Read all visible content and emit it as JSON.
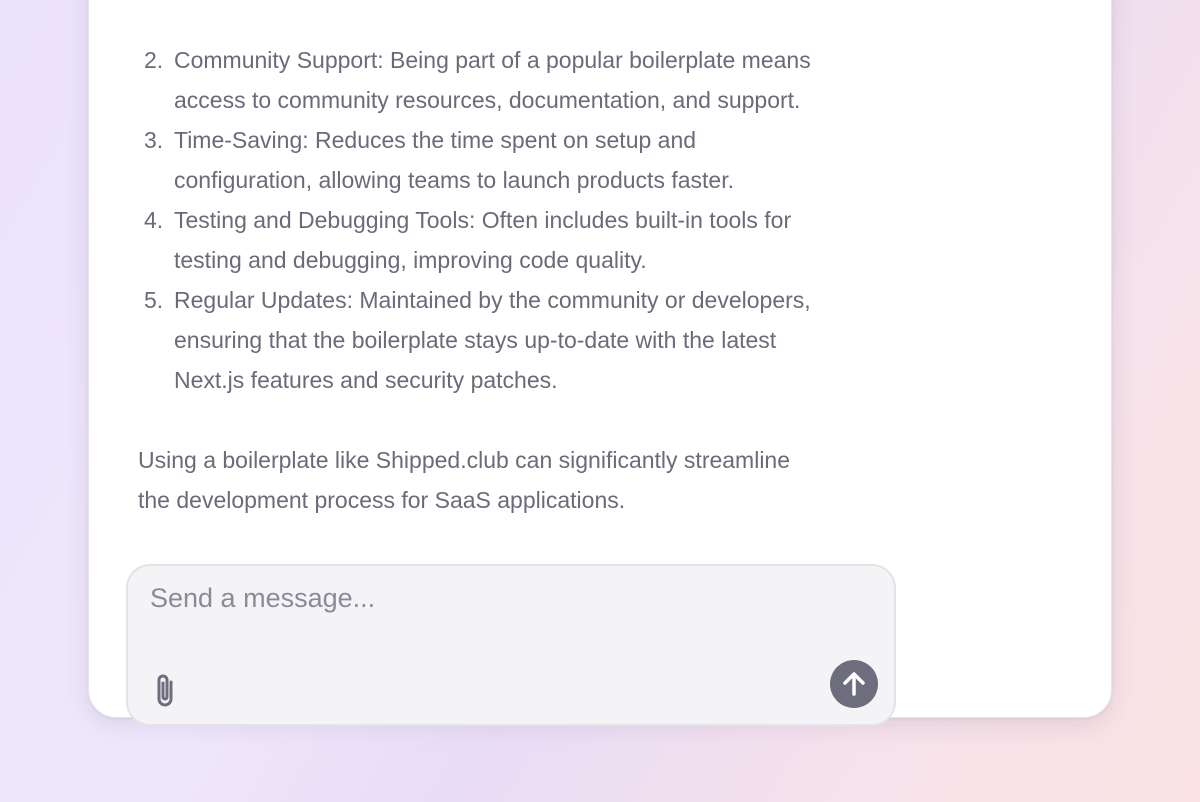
{
  "chat": {
    "list_items": [
      {
        "number": "2.",
        "lines": [
          "Community Support: Being part of a popular boilerplate means",
          "access to community resources, documentation, and support."
        ]
      },
      {
        "number": "3.",
        "lines": [
          "Time-Saving: Reduces the time spent on setup and",
          "configuration, allowing teams to launch products faster."
        ]
      },
      {
        "number": "4.",
        "lines": [
          "Testing and Debugging Tools: Often includes built-in tools for",
          "testing and debugging, improving code quality."
        ]
      },
      {
        "number": "5.",
        "lines": [
          "Regular Updates: Maintained by the community or developers,",
          "ensuring that the boilerplate stays up-to-date with the latest",
          "Next.js features and security patches."
        ]
      }
    ],
    "summary_lines": [
      "Using a boilerplate like Shipped.club can significantly streamline",
      "the development process for SaaS applications."
    ]
  },
  "composer": {
    "placeholder": "Send a message...",
    "value": "",
    "attach_icon": "paperclip-icon",
    "send_icon": "arrow-up-icon"
  },
  "colors": {
    "text": "#6b6a78",
    "send_button": "#6e6d7d",
    "composer_bg": "#f4f4f7"
  }
}
